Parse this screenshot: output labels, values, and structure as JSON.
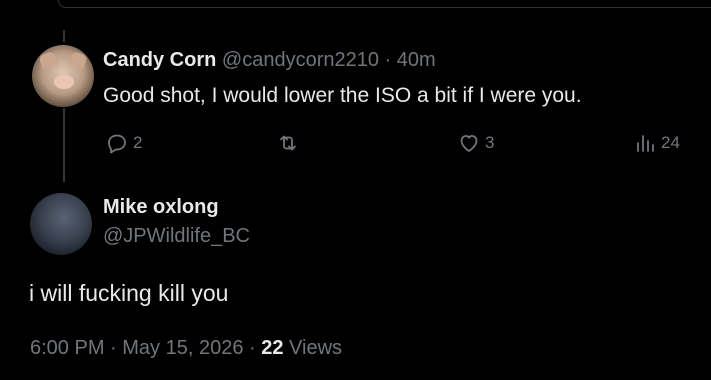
{
  "reply": {
    "display_name": "Candy Corn",
    "handle": "@candycorn2210",
    "separator": " · ",
    "time": "40m",
    "text": "Good shot, I would lower the ISO a bit if I were you.",
    "actions": {
      "reply_count": "2",
      "like_count": "3",
      "views_count": "24"
    }
  },
  "main_post": {
    "display_name": "Mike oxlong",
    "handle": "@JPWildlife_BC",
    "text": "i will fucking kill you",
    "time": "6:00 PM",
    "dot": " · ",
    "date": "May 15, 2026",
    "views_count": "22",
    "views_label": " Views"
  },
  "icons": {
    "reply": "reply-icon",
    "retweet": "retweet-icon",
    "like": "heart-icon",
    "views": "views-bar-chart-icon"
  },
  "colors": {
    "background": "#000000",
    "primary_text": "#e7e9ea",
    "secondary_text": "#71767b",
    "divider": "#2f3336"
  }
}
